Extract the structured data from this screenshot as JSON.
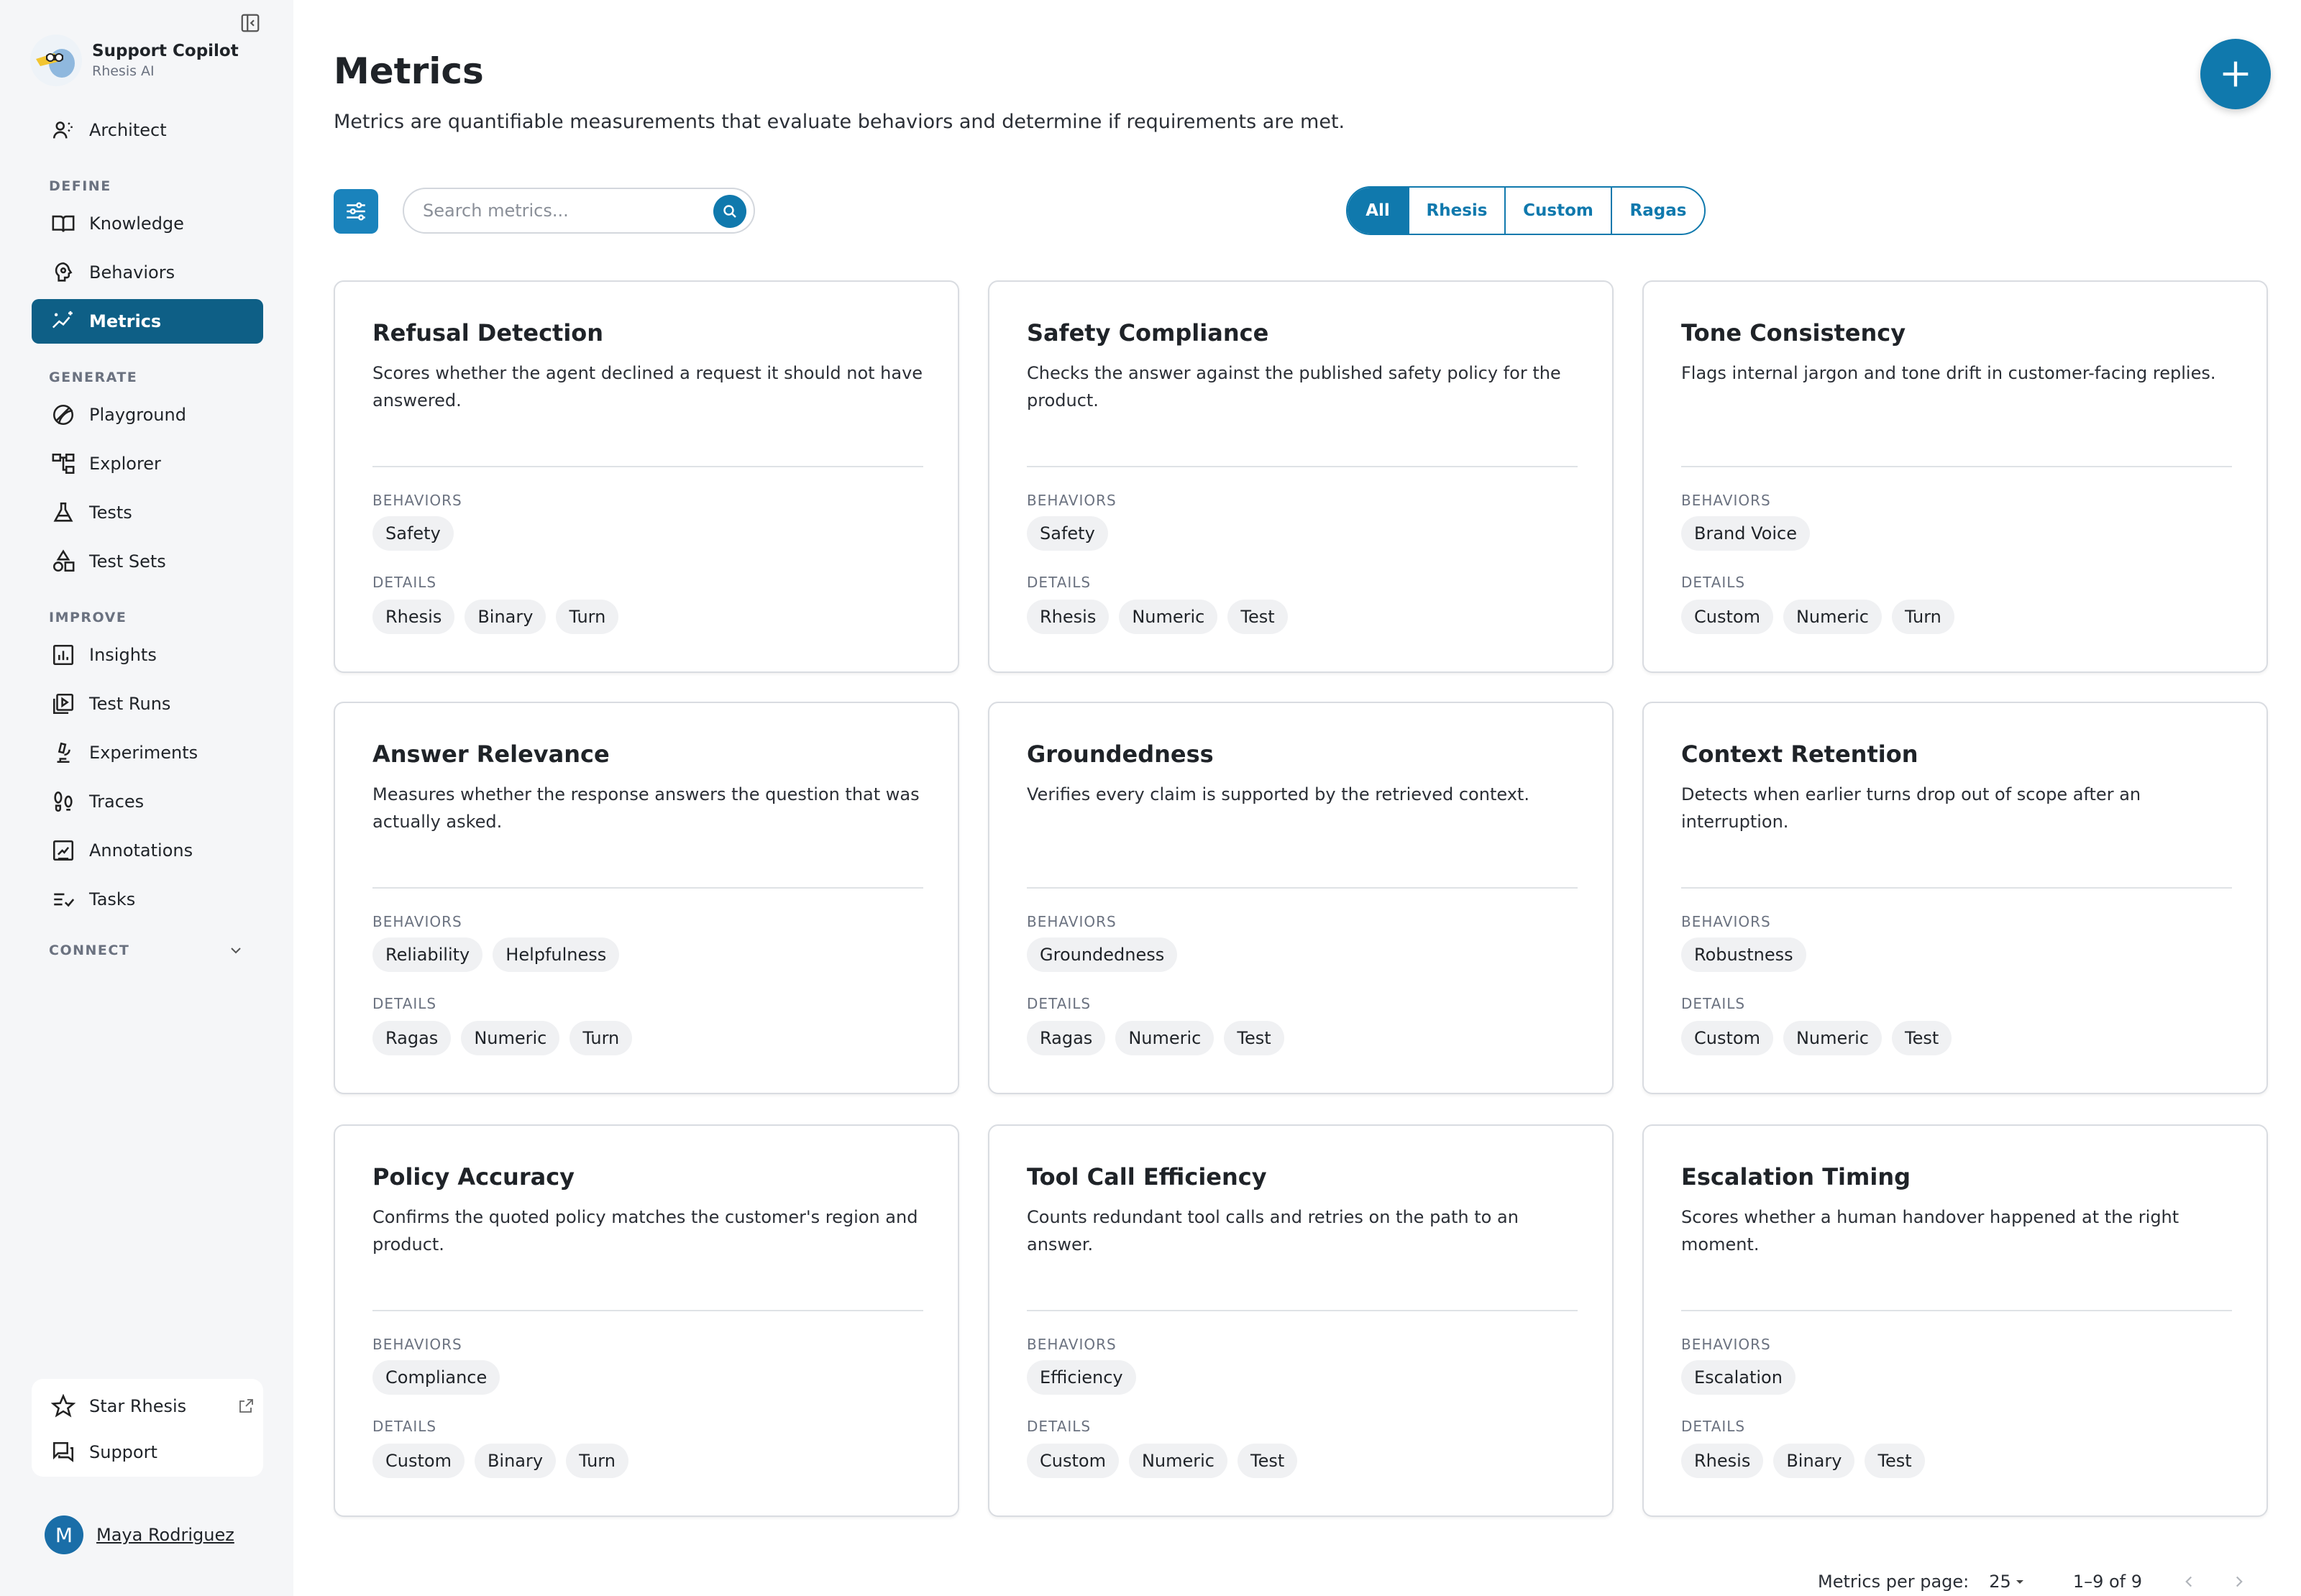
{
  "sidebar": {
    "brand": {
      "name": "Support Copilot",
      "subtitle": "Rhesis AI"
    },
    "top_item": {
      "label": "Architect",
      "icon": "architect-icon"
    },
    "sections": [
      {
        "label": "DEFINE",
        "items": [
          {
            "label": "Knowledge",
            "icon": "book-icon"
          },
          {
            "label": "Behaviors",
            "icon": "brain-icon"
          },
          {
            "label": "Metrics",
            "icon": "sparkle-chart-icon",
            "active": true
          }
        ]
      },
      {
        "label": "GENERATE",
        "items": [
          {
            "label": "Playground",
            "icon": "playground-icon"
          },
          {
            "label": "Explorer",
            "icon": "tree-icon"
          },
          {
            "label": "Tests",
            "icon": "flask-icon"
          },
          {
            "label": "Test Sets",
            "icon": "shapes-icon"
          }
        ]
      },
      {
        "label": "IMPROVE",
        "items": [
          {
            "label": "Insights",
            "icon": "bar-chart-icon"
          },
          {
            "label": "Test Runs",
            "icon": "play-list-icon"
          },
          {
            "label": "Experiments",
            "icon": "microscope-icon"
          },
          {
            "label": "Traces",
            "icon": "footprints-icon"
          },
          {
            "label": "Annotations",
            "icon": "annotation-icon"
          },
          {
            "label": "Tasks",
            "icon": "checklist-icon"
          }
        ]
      }
    ],
    "connect_label": "CONNECT",
    "bottom": [
      {
        "label": "Star Rhesis",
        "icon": "star-icon"
      },
      {
        "label": "Support",
        "icon": "chat-icon"
      }
    ],
    "user": {
      "initial": "M",
      "name": "Maya Rodriguez"
    }
  },
  "header": {
    "title": "Metrics",
    "description": "Metrics are quantifiable measurements that evaluate behaviors and determine if requirements are met."
  },
  "toolbar": {
    "search_placeholder": "Search metrics...",
    "filters": [
      "All",
      "Rhesis",
      "Custom",
      "Ragas"
    ],
    "active_filter": "All"
  },
  "card_labels": {
    "behaviors": "BEHAVIORS",
    "details": "DETAILS"
  },
  "cards": [
    {
      "title": "Refusal Detection",
      "description": "Scores whether the agent declined a request it should not have answered.",
      "behaviors": [
        "Safety"
      ],
      "details": [
        "Rhesis",
        "Binary",
        "Turn"
      ]
    },
    {
      "title": "Safety Compliance",
      "description": "Checks the answer against the published safety policy for the product.",
      "behaviors": [
        "Safety"
      ],
      "details": [
        "Rhesis",
        "Numeric",
        "Test"
      ]
    },
    {
      "title": "Tone Consistency",
      "description": "Flags internal jargon and tone drift in customer-facing replies.",
      "behaviors": [
        "Brand Voice"
      ],
      "details": [
        "Custom",
        "Numeric",
        "Turn"
      ]
    },
    {
      "title": "Answer Relevance",
      "description": "Measures whether the response answers the question that was actually asked.",
      "behaviors": [
        "Reliability",
        "Helpfulness"
      ],
      "details": [
        "Ragas",
        "Numeric",
        "Turn"
      ]
    },
    {
      "title": "Groundedness",
      "description": "Verifies every claim is supported by the retrieved context.",
      "behaviors": [
        "Groundedness"
      ],
      "details": [
        "Ragas",
        "Numeric",
        "Test"
      ]
    },
    {
      "title": "Context Retention",
      "description": "Detects when earlier turns drop out of scope after an interruption.",
      "behaviors": [
        "Robustness"
      ],
      "details": [
        "Custom",
        "Numeric",
        "Test"
      ]
    },
    {
      "title": "Policy Accuracy",
      "description": "Confirms the quoted policy matches the customer's region and product.",
      "behaviors": [
        "Compliance"
      ],
      "details": [
        "Custom",
        "Binary",
        "Turn"
      ]
    },
    {
      "title": "Tool Call Efficiency",
      "description": "Counts redundant tool calls and retries on the path to an answer.",
      "behaviors": [
        "Efficiency"
      ],
      "details": [
        "Custom",
        "Numeric",
        "Test"
      ]
    },
    {
      "title": "Escalation Timing",
      "description": "Scores whether a human handover happened at the right moment.",
      "behaviors": [
        "Escalation"
      ],
      "details": [
        "Rhesis",
        "Binary",
        "Test"
      ]
    }
  ],
  "pagination": {
    "per_page_label": "Metrics per page:",
    "per_page": "25",
    "range": "1–9 of 9"
  },
  "colors": {
    "accent": "#1079ad",
    "active_nav": "#0e5f86",
    "chip_bg": "#f0f1f3"
  }
}
